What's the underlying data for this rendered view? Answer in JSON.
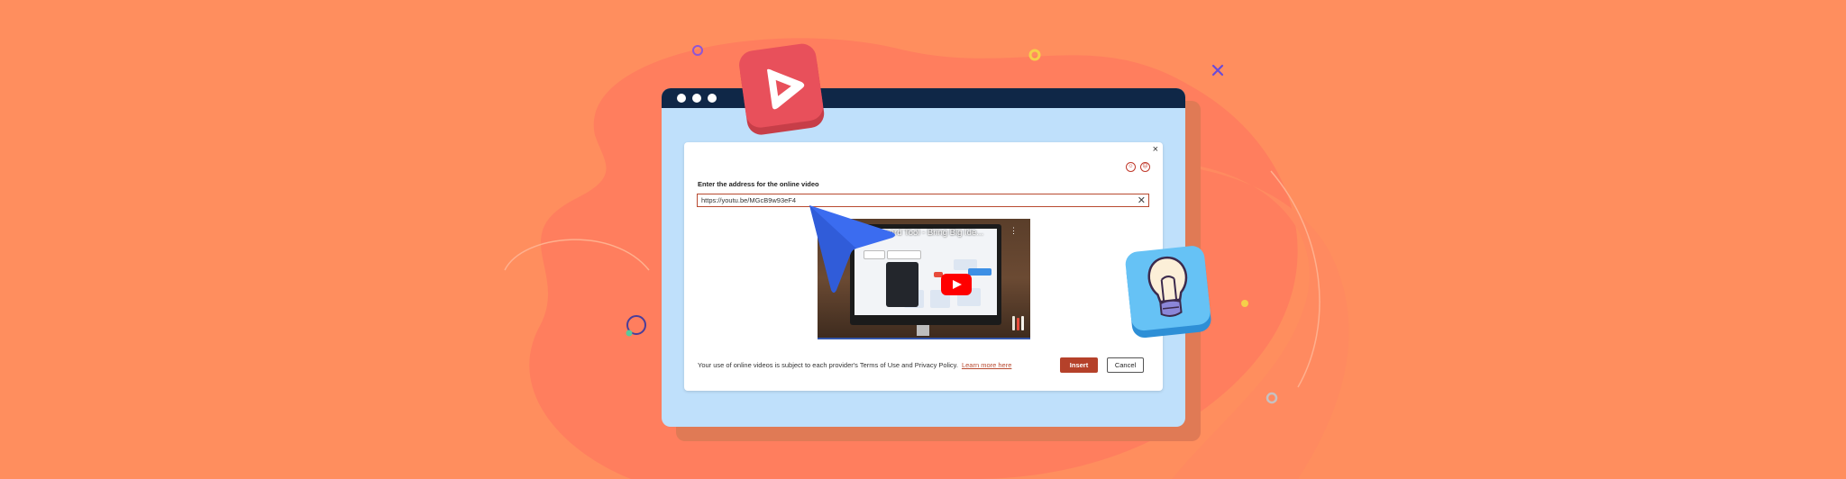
{
  "colors": {
    "background": "#FF8E5E",
    "blob": "#FF7F5E",
    "window_body": "#BFE0FB",
    "window_titlebar": "#0F2747",
    "accent": "#B5412A",
    "play_sticker": "#E8505B",
    "bulb_sticker": "#4FB3F2",
    "cursor": "#3B6CF0"
  },
  "dialog": {
    "close_glyph": "×",
    "prompt_label": "Enter the address for the online video",
    "url_value": "https://youtu.be/MGcB9w93eF4",
    "clear_glyph": "✕",
    "video_title": "...eboard Tool - Bring Big Ide...",
    "terms_text": "Your use of online videos is subject to each provider's Terms of Use and Privacy Policy.",
    "learn_more": "Learn more here",
    "insert_label": "Insert",
    "cancel_label": "Cancel"
  },
  "icons": {
    "play_sticker": "play-icon",
    "bulb_sticker": "lightbulb-icon",
    "cursor": "cursor-arrow-icon"
  }
}
